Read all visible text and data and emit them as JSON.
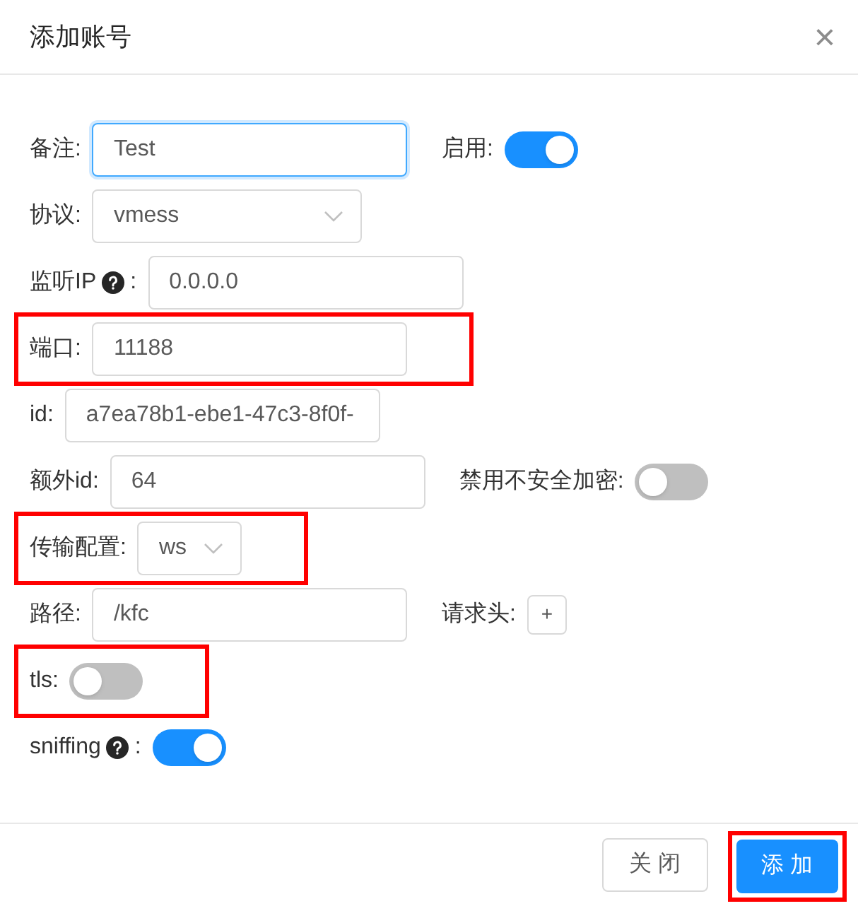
{
  "dialog": {
    "title": "添加账号",
    "close": "×"
  },
  "rows": [
    {
      "highlighted": false,
      "items": [
        {
          "kind": "input",
          "label": "备注:",
          "value": "Test",
          "focused": true
        },
        {
          "kind": "switch",
          "label": "启用:",
          "on": true
        }
      ]
    },
    {
      "highlighted": false,
      "items": [
        {
          "kind": "select",
          "label": "协议:",
          "value": "vmess",
          "compact": false
        }
      ]
    },
    {
      "highlighted": false,
      "items": [
        {
          "kind": "input",
          "label": "监听IP",
          "help": true,
          "colon": ":",
          "value": "0.0.0.0",
          "focused": false
        }
      ]
    },
    {
      "highlighted": true,
      "items": [
        {
          "kind": "input",
          "label": "端口:",
          "value": "11188",
          "focused": false
        }
      ]
    },
    {
      "highlighted": false,
      "items": [
        {
          "kind": "input",
          "label": "id:",
          "value": "a7ea78b1-ebe1-47c3-8f0f-",
          "focused": false
        }
      ]
    },
    {
      "highlighted": false,
      "items": [
        {
          "kind": "input",
          "label": "额外id:",
          "value": "64",
          "focused": false
        },
        {
          "kind": "switch",
          "label": "禁用不安全加密:",
          "on": false
        }
      ]
    },
    {
      "highlighted": true,
      "items": [
        {
          "kind": "select",
          "label": "传输配置:",
          "value": "ws",
          "compact": true
        }
      ]
    },
    {
      "highlighted": false,
      "items": [
        {
          "kind": "input",
          "label": "路径:",
          "value": "/kfc",
          "focused": false
        },
        {
          "kind": "add",
          "label": "请求头:",
          "text": "+"
        }
      ]
    },
    {
      "highlighted": true,
      "items": [
        {
          "kind": "switch",
          "label": "tls:",
          "on": false
        }
      ]
    },
    {
      "highlighted": false,
      "items": [
        {
          "kind": "switch",
          "label": "sniffing",
          "help": true,
          "colon": ":",
          "on": true
        }
      ]
    }
  ],
  "footer": [
    {
      "label": "关 闭",
      "primary": false,
      "highlighted": false
    },
    {
      "label": "添 加",
      "primary": true,
      "highlighted": true
    }
  ]
}
